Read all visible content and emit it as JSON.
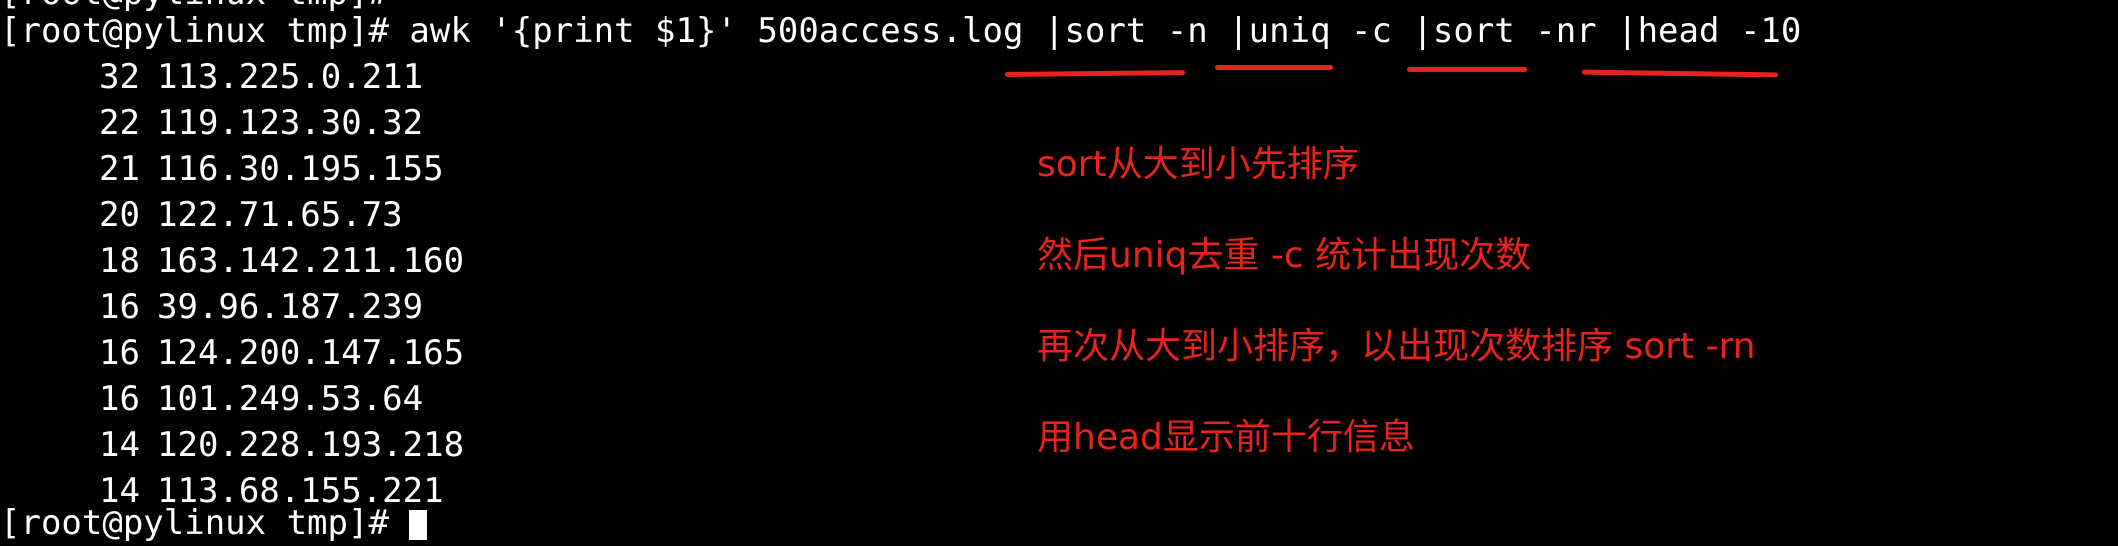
{
  "terminal": {
    "previous_line": "[root@pylinux tmp]#",
    "prompt": "[root@pylinux tmp]# ",
    "command": "awk '{print $1}' 500access.log |sort -n |uniq -c |sort -nr |head -10",
    "output": [
      {
        "count": "32",
        "ip": "113.225.0.211"
      },
      {
        "count": "22",
        "ip": "119.123.30.32"
      },
      {
        "count": "21",
        "ip": "116.30.195.155"
      },
      {
        "count": "20",
        "ip": "122.71.65.73"
      },
      {
        "count": "18",
        "ip": "163.142.211.160"
      },
      {
        "count": "16",
        "ip": "39.96.187.239"
      },
      {
        "count": "16",
        "ip": "124.200.147.165"
      },
      {
        "count": "16",
        "ip": "101.249.53.64"
      },
      {
        "count": "14",
        "ip": "120.228.193.218"
      },
      {
        "count": "14",
        "ip": "113.68.155.221"
      }
    ],
    "next_prompt": "[root@pylinux tmp]# "
  },
  "annotations": [
    "sort从大到小先排序",
    "然后uniq去重 -c 统计出现次数",
    "再次从大到小排序，以出现次数排序 sort -rn",
    "用head显示前十行信息"
  ],
  "colors": {
    "background": "#000000",
    "text": "#ffffff",
    "annotation": "#e8221c"
  }
}
